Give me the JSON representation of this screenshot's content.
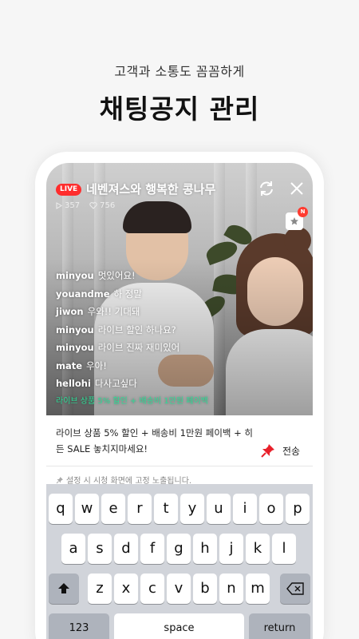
{
  "promo": {
    "subtitle": "고객과 소통도 꼼꼼하게",
    "headline": "채팅공지 관리"
  },
  "live": {
    "badge": "LIVE",
    "title": "네벤져스와 행복한 콩나무",
    "views": "357",
    "likes": "756",
    "store_badge": "N"
  },
  "chat": [
    {
      "user": "minyou",
      "message": "멋있어요!"
    },
    {
      "user": "youandme",
      "message": "하 정말"
    },
    {
      "user": "jiwon",
      "message": "우와!! 기대돼"
    },
    {
      "user": "minyou",
      "message": "라이브 할인 하나요?"
    },
    {
      "user": "minyou",
      "message": "라이브 진짜 재미있어"
    },
    {
      "user": "mate",
      "message": "우아!"
    },
    {
      "user": "hellohi",
      "message": "다사고싶다"
    }
  ],
  "chat_notice": "라이브 상품 5% 할인 + 배송비 1만원 페이백",
  "notice": {
    "text": "라이브 상품 5% 할인 + 배송비 1만원 페이백 + 히든 SALE 놓치지마세요!",
    "send_label": "전송",
    "hint": "설정 시 시청 화면에 고정 노출됩니다."
  },
  "keyboard": {
    "row1": [
      "q",
      "w",
      "e",
      "r",
      "t",
      "y",
      "u",
      "i",
      "o",
      "p"
    ],
    "row2": [
      "a",
      "s",
      "d",
      "f",
      "g",
      "h",
      "j",
      "k",
      "l"
    ],
    "row3": [
      "z",
      "x",
      "c",
      "v",
      "b",
      "n",
      "m"
    ],
    "numbers_label": "123",
    "space_label": "space",
    "return_label": "return"
  },
  "colors": {
    "live_red": "#ff2d2d",
    "notice_green": "#2dde98",
    "pin_red": "#e8202a"
  }
}
